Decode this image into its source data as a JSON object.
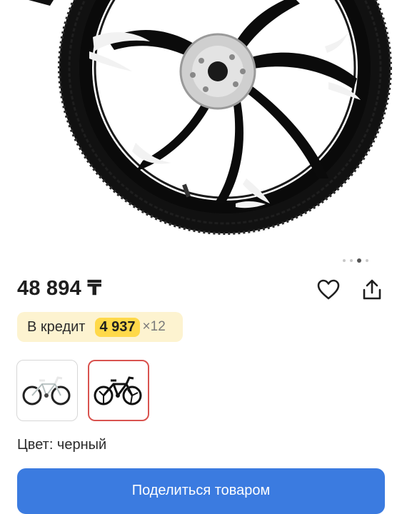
{
  "product": {
    "price": "48 894 ₸",
    "color_label": "Цвет: черный"
  },
  "credit": {
    "label": "В кредит",
    "amount": "4 937",
    "multiplier": "×12"
  },
  "gallery": {
    "dots_count": 4,
    "active_dot": 2,
    "thumbnails": [
      {
        "icon": "bike-white-icon",
        "selected": false
      },
      {
        "icon": "bike-black-icon",
        "selected": true
      }
    ]
  },
  "actions": {
    "favorite_icon": "heart-icon",
    "share_icon": "share-icon",
    "share_button": "Поделиться товаром"
  },
  "colors": {
    "accent": "#3b7be0",
    "credit_bg": "#fdf3d0",
    "credit_amount_bg": "#ffd94a",
    "selected_border": "#d9534f"
  }
}
